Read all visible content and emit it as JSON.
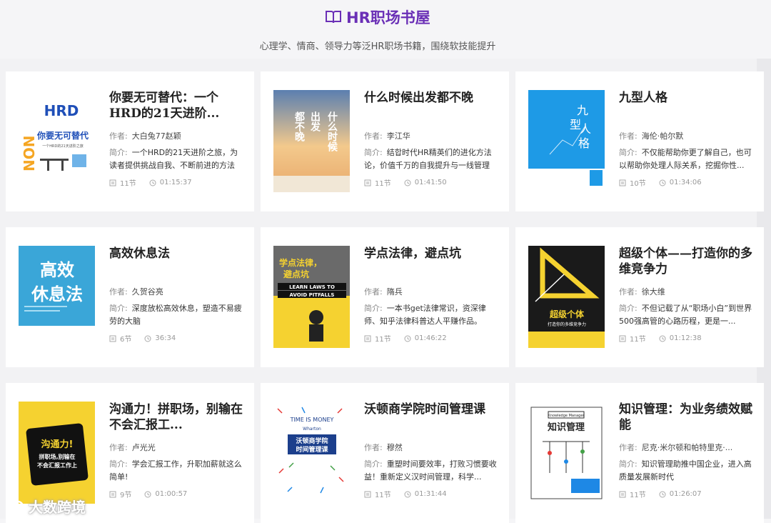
{
  "header": {
    "title": "HR职场书屋",
    "subtitle": "心理学、情商、领导力等泛HR职场书籍，围绕软技能提升"
  },
  "labels": {
    "author": "作者:",
    "desc": "简介:"
  },
  "books": [
    {
      "title": "你要无可替代：一个HRD的21天进阶...",
      "author": "大白兔77赵颖",
      "desc": "一个HRD的21天进阶之旅，为读者提供挑战自我、不断前进的方法",
      "lessons": "11节",
      "duration": "01:15:37",
      "cover": {
        "bg": "#ffffff",
        "accent": "#1f4fb8",
        "lines": [
          "HRD",
          "你要无可替代",
          "一个HRD的21天进阶之旅"
        ],
        "side": "NON"
      }
    },
    {
      "title": "什么时候出发都不晚",
      "author": "李江华",
      "desc": "结합时代HR精英们的进化方法论，价值千万的自我提升与一线管理",
      "lessons": "11节",
      "duration": "01:41:50",
      "cover": {
        "bg": "#f3c98c",
        "accent": "#ffffff",
        "lines": [
          "什么时候",
          "出发",
          "都不晚"
        ]
      }
    },
    {
      "title": "九型人格",
      "author": "海伦·帕尔默",
      "desc": "不仅能帮助你更了解自己，也可以帮助你处理人际关系，挖掘你性...",
      "lessons": "10节",
      "duration": "01:34:06",
      "cover": {
        "bg": "#1e9ae6",
        "accent": "#ffffff",
        "lines": [
          "九型",
          "人格"
        ]
      }
    },
    {
      "title": "高效休息法",
      "author": "久贺谷亮",
      "desc": "深度放松高效休息，塑造不易疲劳的大脑",
      "lessons": "6节",
      "duration": "36:34",
      "cover": {
        "bg": "#3aa6d8",
        "accent": "#ffffff",
        "lines": [
          "高效",
          "休息法"
        ]
      }
    },
    {
      "title": "学点法律，避点坑",
      "author": "隋兵",
      "desc": "一本书get法律常识，资深律师、知乎法律科普达人平赚作品。",
      "lessons": "11节",
      "duration": "01:46:22",
      "cover": {
        "bg": "#f5d230",
        "accent": "#222222",
        "lines": [
          "学点法律，",
          "避点坑",
          "LEARN LAWS TO",
          "AVOID PITFALLS"
        ]
      }
    },
    {
      "title": "超级个体——打造你的多维竞争力",
      "author": "徐大维",
      "desc": "不但记载了从“职场小白”到世界500强高管的心路历程，更是一...",
      "lessons": "11节",
      "duration": "01:12:38",
      "cover": {
        "bg": "#1a1a1a",
        "accent": "#f5d230",
        "lines": [
          "超级个体",
          "打造你的多维竞争力"
        ]
      }
    },
    {
      "title": "沟通力！拼职场，别输在不会汇报工...",
      "author": "卢光光",
      "desc": "学会汇报工作，升职加薪就这么简单!",
      "lessons": "9节",
      "duration": "01:00:57",
      "cover": {
        "bg": "#f5d230",
        "accent": "#111111",
        "lines": [
          "沟通力!",
          "拼职场,别输在",
          "不会汇报工作上"
        ]
      }
    },
    {
      "title": "沃顿商学院时间管理课",
      "author": "穆然",
      "desc": "重塑时间要效率，打败习惯要收益！重新定义汉时间管理，科学...",
      "lessons": "11节",
      "duration": "01:31:44",
      "cover": {
        "bg": "#ffffff",
        "accent": "#1c3f8c",
        "lines": [
          "TIME IS MONEY",
          "Wharton",
          "沃顿商学院",
          "时间管理课"
        ]
      }
    },
    {
      "title": "知识管理：为业务绩效赋能",
      "author": "尼克·米尔顿和帕特里克·...",
      "desc": "知识管理助推中国企业，进入高质量发展新时代",
      "lessons": "11节",
      "duration": "01:26:07",
      "cover": {
        "bg": "#ffffff",
        "accent": "#2a2a2a",
        "lines": [
          "Knowledge Manager",
          "知识管理"
        ]
      }
    }
  ],
  "watermark": "大数跨境"
}
